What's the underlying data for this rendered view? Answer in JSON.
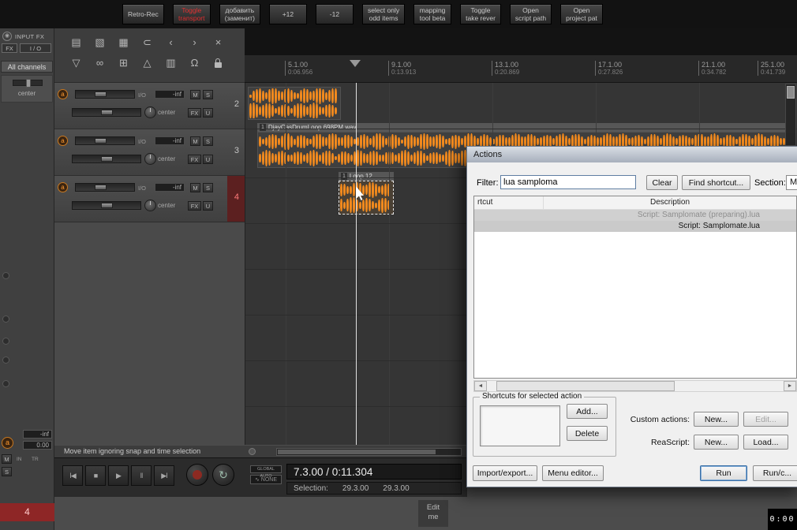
{
  "top_toolbar": {
    "buttons": [
      {
        "label": "Retro-Rec",
        "accent": false
      },
      {
        "label": "Toggle\ntransport",
        "accent": true
      },
      {
        "label": "добавить\n(заменит)",
        "accent": false
      },
      {
        "label": "+12",
        "accent": false
      },
      {
        "label": "-12",
        "accent": false
      },
      {
        "label": "select only\nodd items",
        "accent": false
      },
      {
        "label": "mapping\ntool beta",
        "accent": false
      },
      {
        "label": "Toggle\ntake rever",
        "accent": false
      },
      {
        "label": "Open\nscript path",
        "accent": false
      },
      {
        "label": "Open\nproject pat",
        "accent": false
      }
    ]
  },
  "left_rail": {
    "power_glyph": "◉",
    "input_fx": "INPUT FX",
    "fx": "FX",
    "io": "I / O",
    "all_channels": "All channels",
    "pan_label": "center",
    "master_vol": "-inf",
    "master_pan": "0.00",
    "in_label": "IN",
    "tr_label": "TR",
    "mute": "M",
    "solo": "S",
    "arm": "a",
    "track_number": "4"
  },
  "tcp_toolbar": {
    "row1": [
      {
        "name": "new-project-icon",
        "glyph": "▤"
      },
      {
        "name": "open-project-icon",
        "glyph": "▧"
      },
      {
        "name": "save-project-icon",
        "glyph": "▦"
      },
      {
        "name": "paperclip-icon",
        "glyph": "⊂"
      },
      {
        "name": "undo-icon",
        "glyph": "‹"
      },
      {
        "name": "redo-icon",
        "glyph": "›"
      },
      {
        "name": "crossfade-icon",
        "glyph": "×"
      }
    ],
    "row2": [
      {
        "name": "filter-icon",
        "glyph": "▽"
      },
      {
        "name": "item-grouping-icon",
        "glyph": "∞"
      },
      {
        "name": "grid-icon",
        "glyph": "⊞"
      },
      {
        "name": "envelope-icon",
        "glyph": "△"
      },
      {
        "name": "grid-lines-icon",
        "glyph": "▥"
      },
      {
        "name": "snap-magnet-icon",
        "glyph": "Ω"
      },
      {
        "name": "lock-icon",
        "glyph": ""
      }
    ]
  },
  "tracks": {
    "shared": {
      "arm": "a",
      "io": "I/O",
      "vol": "-inf",
      "mute": "M",
      "solo": "S",
      "pan": "center",
      "fx": "FX",
      "env": "U"
    },
    "list": [
      {
        "number": "2",
        "selected": false
      },
      {
        "number": "3",
        "selected": false
      },
      {
        "number": "4",
        "selected": true
      }
    ]
  },
  "ruler": {
    "marks": [
      {
        "bar": "5.1.00",
        "time": "0:06.956"
      },
      {
        "bar": "9.1.00",
        "time": "0:13.913"
      },
      {
        "bar": "13.1.00",
        "time": "0:20.869"
      },
      {
        "bar": "17.1.00",
        "time": "0:27.826"
      },
      {
        "bar": "21.1.00",
        "time": "0:34.782"
      },
      {
        "bar": "25.1.00",
        "time": "0:41.739"
      }
    ]
  },
  "media_items": [
    {
      "track": "2",
      "take_number": "",
      "name": ""
    },
    {
      "track": "3",
      "take_number": "1",
      "name": "DjayCasDrumLoop 698PM.wav"
    },
    {
      "track": "4",
      "take_number": "1",
      "name": "Loop 12..."
    }
  ],
  "actions_dialog": {
    "title": "Actions",
    "filter_label": "Filter:",
    "filter_value": "lua samploma",
    "clear_label": "Clear",
    "find_shortcut_label": "Find shortcut...",
    "section_label": "Section:",
    "section_value": "M",
    "col_shortcut": "rtcut",
    "col_description": "Description",
    "rows": [
      {
        "description": "Script: Samplomate (preparing).lua"
      },
      {
        "description": "Script: Samplomate.lua"
      }
    ],
    "group_title": "Shortcuts for selected action",
    "add_label": "Add...",
    "delete_label": "Delete",
    "custom_actions_label": "Custom actions:",
    "custom_new_label": "New...",
    "custom_edit_label": "Edit...",
    "reascript_label": "ReaScript:",
    "reascript_new_label": "New...",
    "reascript_load_label": "Load...",
    "import_export_label": "Import/export...",
    "menu_editor_label": "Menu editor...",
    "run_label": "Run",
    "run_close_label": "Run/c...",
    "scroll_left_glyph": "◄",
    "scroll_right_glyph": "►"
  },
  "transport": {
    "status_text": "Move item ignoring snap and time selection",
    "buttons": [
      {
        "name": "go-to-start-button",
        "glyph": "I◀"
      },
      {
        "name": "stop-button",
        "glyph": "■"
      },
      {
        "name": "play-button",
        "glyph": "▶"
      },
      {
        "name": "pause-button",
        "glyph": "‖"
      },
      {
        "name": "go-to-end-button",
        "glyph": "▶I"
      }
    ],
    "loop_glyph": "↻",
    "global_auto": "GLOBAL AUTO",
    "auto_mode": "∿ NONE",
    "position": "7.3.00 / 0:11.304",
    "selection_label": "Selection:",
    "selection_start": "29.3.00",
    "selection_end": "29.3.00"
  },
  "bottom": {
    "edit_me": "Edit\nme",
    "timer": "0:00"
  },
  "colors": {
    "waveform_orange": "#f28a1e",
    "accent_red": "#e03030",
    "record_red": "#8c2a22"
  }
}
